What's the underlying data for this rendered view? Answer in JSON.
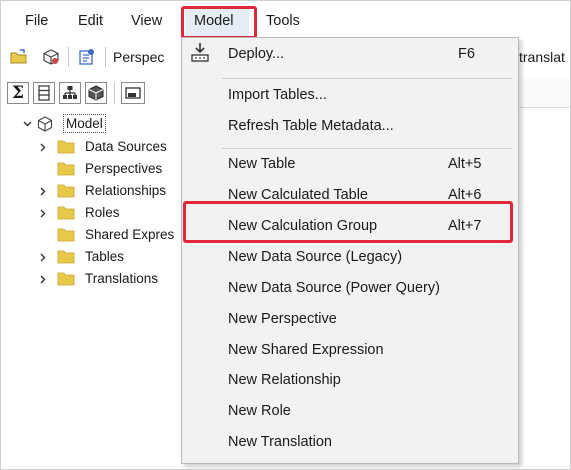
{
  "menubar": {
    "items": [
      {
        "label": "File"
      },
      {
        "label": "Edit"
      },
      {
        "label": "View"
      },
      {
        "label": "Model"
      },
      {
        "label": "Tools"
      }
    ]
  },
  "toolbar": {
    "perspective_label": "Perspec",
    "translation_label": "translat"
  },
  "tree": {
    "root": "Model",
    "items": [
      {
        "label": "Data Sources",
        "expandable": true
      },
      {
        "label": "Perspectives",
        "expandable": false
      },
      {
        "label": "Relationships",
        "expandable": true
      },
      {
        "label": "Roles",
        "expandable": true
      },
      {
        "label": "Shared Expres",
        "expandable": false
      },
      {
        "label": "Tables",
        "expandable": true
      },
      {
        "label": "Translations",
        "expandable": true
      }
    ]
  },
  "model_menu": {
    "groups": [
      [
        {
          "label": "Deploy...",
          "shortcut": "F6",
          "icon": "deploy-icon"
        }
      ],
      [
        {
          "label": "Import Tables...",
          "shortcut": ""
        },
        {
          "label": "Refresh Table Metadata...",
          "shortcut": ""
        }
      ],
      [
        {
          "label": "New Table",
          "shortcut": "Alt+5"
        },
        {
          "label": "New Calculated Table",
          "shortcut": "Alt+6"
        },
        {
          "label": "New Calculation Group",
          "shortcut": "Alt+7",
          "highlighted": true
        },
        {
          "label": "New Data Source (Legacy)",
          "shortcut": ""
        },
        {
          "label": "New Data Source (Power Query)",
          "shortcut": ""
        },
        {
          "label": "New Perspective",
          "shortcut": ""
        },
        {
          "label": "New Shared Expression",
          "shortcut": ""
        },
        {
          "label": "New Relationship",
          "shortcut": ""
        },
        {
          "label": "New Role",
          "shortcut": ""
        },
        {
          "label": "New Translation",
          "shortcut": ""
        }
      ]
    ]
  },
  "colors": {
    "highlight_border": "#e0283a",
    "menu_background": "#f2f2f2",
    "folder": "#e8c84a",
    "open_menu_background": "#e4ecf6"
  }
}
